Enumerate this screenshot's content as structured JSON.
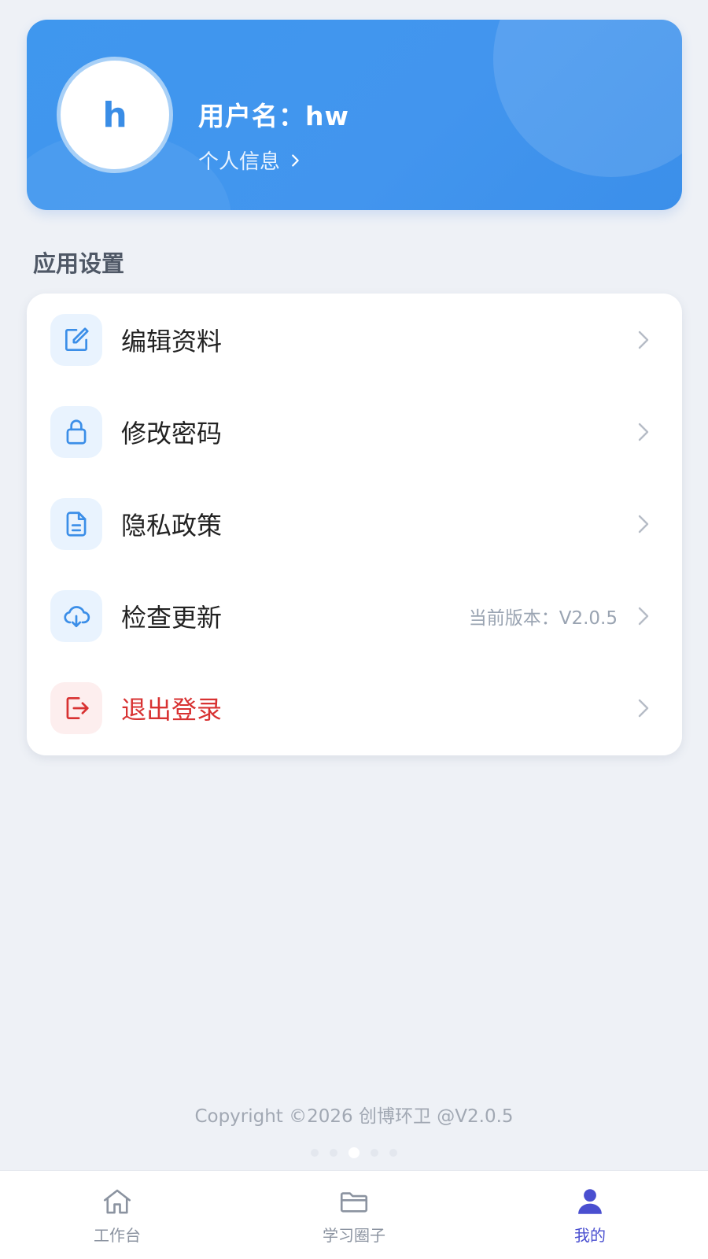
{
  "profile": {
    "avatar_letter": "h",
    "username": "用户名：hw",
    "info_link": "个人信息"
  },
  "settings": {
    "title": "应用设置",
    "items": [
      {
        "label": "编辑资料",
        "icon": "edit-icon"
      },
      {
        "label": "修改密码",
        "icon": "lock-icon"
      },
      {
        "label": "隐私政策",
        "icon": "document-icon"
      },
      {
        "label": "检查更新",
        "icon": "cloud-download-icon",
        "extra": "当前版本：V2.0.5"
      },
      {
        "label": "退出登录",
        "icon": "logout-icon",
        "danger": true
      }
    ]
  },
  "footer": {
    "copyright": "Copyright ©2026 创博环卫 @V2.0.5"
  },
  "tabbar": {
    "tabs": [
      {
        "label": "工作台",
        "icon": "home-icon",
        "active": false
      },
      {
        "label": "学习圈子",
        "icon": "folder-icon",
        "active": false
      },
      {
        "label": "我的",
        "icon": "user-icon",
        "active": true
      }
    ]
  },
  "colors": {
    "primary": "#4295ee",
    "danger": "#d83232",
    "active_tab": "#4a4fd0"
  }
}
